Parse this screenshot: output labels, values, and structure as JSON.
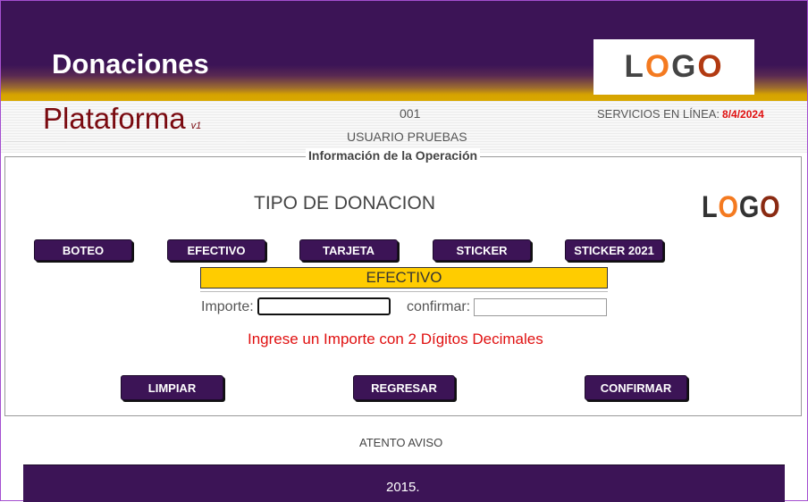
{
  "header": {
    "title": "Donaciones",
    "logo": {
      "parts": [
        {
          "t": "L",
          "c": "#444444"
        },
        {
          "t": "O",
          "c": "#f47a20"
        },
        {
          "t": "G",
          "c": "#444444"
        },
        {
          "t": "O",
          "c": "#b23a12"
        }
      ]
    }
  },
  "subheader": {
    "platform": "Plataforma",
    "version": "v1",
    "code": "001",
    "user": "USUARIO PRUEBAS",
    "services_label": "SERVICIOS EN LÍNEA:",
    "services_date": "8/4/2024"
  },
  "panel": {
    "legend": "Información de la Operación",
    "heading": "TIPO DE DONACION",
    "logo_small": {
      "parts": [
        {
          "t": "L",
          "c": "#333333"
        },
        {
          "t": "O",
          "c": "#f47a20"
        },
        {
          "t": "G",
          "c": "#333333"
        },
        {
          "t": "O",
          "c": "#8a2a12"
        }
      ]
    },
    "type_buttons": [
      "BOTEO",
      "EFECTIVO",
      "TARJETA",
      "STICKER",
      "STICKER 2021"
    ],
    "selected_type": "EFECTIVO",
    "amount_label": "Importe:",
    "amount_value": "",
    "confirm_label": "confirmar:",
    "confirm_value": "",
    "message": "Ingrese un Importe con 2 Dígitos Decimales",
    "actions": {
      "clear": "LIMPIAR",
      "back": "REGRESAR",
      "confirm": "CONFIRMAR"
    }
  },
  "notice": "ATENTO AVISO",
  "footer": {
    "text": "2015."
  },
  "colors": {
    "brand": "#3c1456",
    "gold": "#ffcc00",
    "alert": "#e01010",
    "platform": "#7a0a10"
  }
}
